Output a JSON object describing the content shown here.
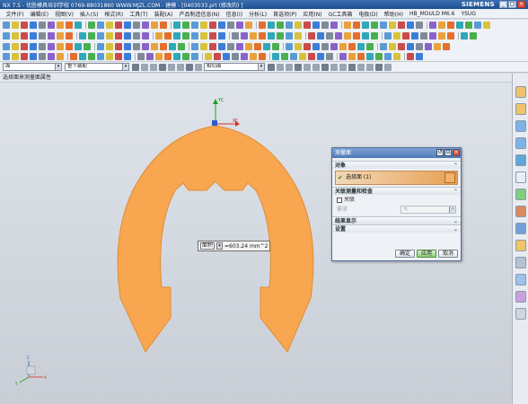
{
  "window": {
    "title": "NX 7.5 - 优胜模具培训学校  0769-88031860  WWW.MJZL.COM - 建模 - [0403033.prt (修改的) ]",
    "brand": "SIEMENS",
    "min_glyph": "_",
    "max_glyph": "□",
    "close_glyph": "×"
  },
  "menu": {
    "items": [
      "文件(F)",
      "编辑(E)",
      "视图(V)",
      "插入(S)",
      "格式(R)",
      "工具(T)",
      "装配(A)",
      "产品制造信息(N)",
      "信息(I)",
      "分析(L)",
      "首选项(P)",
      "应用(N)",
      "GC工具箱",
      "电极(D)",
      "帮助(H)",
      "HB_MOULD M6.6",
      "YSUG"
    ]
  },
  "filterbar": {
    "type_filter": "面",
    "scope_filter": "整个装配",
    "snap_filter": "相切面",
    "dropdown_glyph": "▾"
  },
  "status": {
    "prompt": "选择面来测量面属性"
  },
  "axes": {
    "y_label": "YC",
    "x_label": "XC",
    "triad_z": "Z",
    "triad_y": "Y",
    "triad_x": "X"
  },
  "measure_label": {
    "type": "面积",
    "value": "=603.24 mm^2"
  },
  "dialog": {
    "title": "测量面",
    "title_buttons": [
      "↺",
      "⊡",
      "×"
    ],
    "object_group": "对象",
    "selection": "选择面 (1)",
    "associate_group": "关联测量和检查",
    "associate_check": "关联",
    "requirement_label": "需求",
    "requirement_value": "无",
    "results_group": "结果显示",
    "settings_group": "设置",
    "ok": "确定",
    "apply": "应用",
    "cancel": "取消",
    "collapse_glyph": "⌃",
    "expand_glyph": "⌄"
  },
  "colors": {
    "part_fill": "#f8a650",
    "part_edge": "#e08d33",
    "accent": "#2a62a8"
  }
}
